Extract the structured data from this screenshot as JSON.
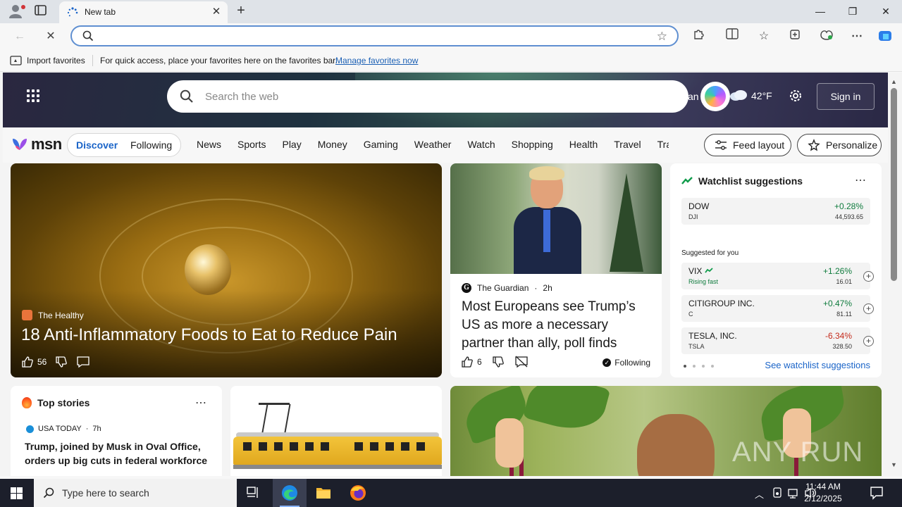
{
  "browser": {
    "tab_title": "New tab",
    "address_value": "",
    "favorites_bar": {
      "import_label": "Import favorites",
      "message": "For quick access, place your favorites here on the favorites bar.",
      "manage_link": "Manage favorites now"
    }
  },
  "msn_header": {
    "search_placeholder": "Search the web",
    "cut_text": "an",
    "temperature": "42°F",
    "sign_in_label": "Sign in"
  },
  "msn_nav": {
    "logo_text": "msn",
    "discover_label": "Discover",
    "following_label": "Following",
    "links": [
      "News",
      "Sports",
      "Play",
      "Money",
      "Gaming",
      "Weather",
      "Watch",
      "Shopping",
      "Health",
      "Travel",
      "Tra"
    ],
    "feed_layout_label": "Feed layout",
    "personalize_label": "Personalize"
  },
  "hero": {
    "source": "The Healthy",
    "title": "18 Anti-Inflammatory Foods to Eat to Reduce Pain",
    "likes": "56"
  },
  "news_card": {
    "source": "The Guardian",
    "age": "2h",
    "title": "Most Europeans see Trump’s US as more a necessary partner than ally, poll finds",
    "likes": "6",
    "following_label": "Following"
  },
  "watchlist": {
    "title": "Watchlist suggestions",
    "primary": {
      "name": "DOW",
      "symbol": "DJI",
      "change": "+0.28%",
      "price": "44,593.65"
    },
    "suggested_label": "Suggested for you",
    "suggested": [
      {
        "name": "VIX",
        "symbol": "Rising fast",
        "change": "+1.26%",
        "price": "16.01",
        "trend": "pos"
      },
      {
        "name": "CITIGROUP INC.",
        "symbol": "C",
        "change": "+0.47%",
        "price": "81.11",
        "trend": "pos"
      },
      {
        "name": "TESLA, INC.",
        "symbol": "TSLA",
        "change": "-6.34%",
        "price": "328.50",
        "trend": "neg"
      }
    ],
    "see_more_label": "See watchlist suggestions"
  },
  "top_stories": {
    "title": "Top stories",
    "source": "USA TODAY",
    "age": "7h",
    "headline": "Trump, joined by Musk in Oval Office, orders up big cuts in federal workforce"
  },
  "beet_card": {
    "watermark": "ANY RUN"
  },
  "taskbar": {
    "search_placeholder": "Type here to search",
    "time": "11:44 AM",
    "date": "2/12/2025"
  },
  "colors": {
    "accent": "#1a64c8",
    "positive": "#0f7b3d",
    "negative": "#c42b1c",
    "taskbar": "#1c1f2b"
  }
}
